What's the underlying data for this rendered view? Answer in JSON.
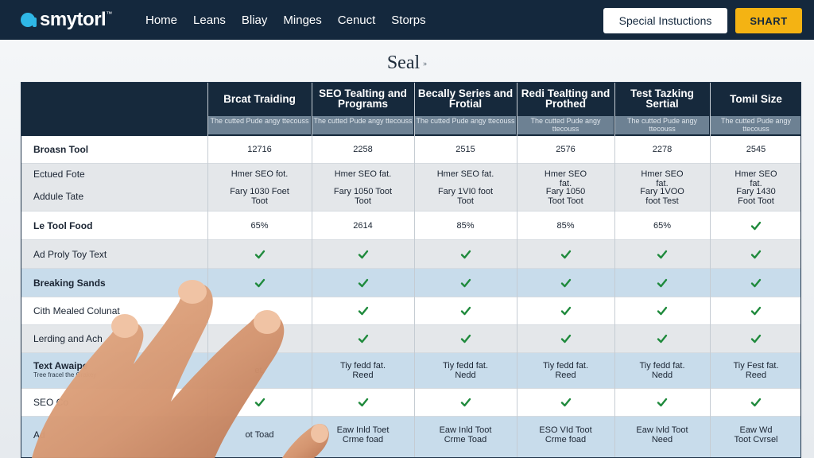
{
  "nav": {
    "logo_text": "smytorl",
    "logo_tm": "™",
    "items": [
      "Home",
      "Leans",
      "Bliay",
      "Minges",
      "Cenuct",
      "Storps"
    ],
    "special_label": "Special Instuctions",
    "start_label": "SHART"
  },
  "page": {
    "title": "Seal",
    "title_mark": "»"
  },
  "table": {
    "columns": [
      {
        "title": "Brcat Traiding",
        "sub": "The cutted Pude angy ttecouss"
      },
      {
        "title": "SEO Tealting and Programs",
        "sub": "The cutted Pude angy ttecouss"
      },
      {
        "title": "Becally Series and Frotial",
        "sub": "The cutted Pude angy ttecouss"
      },
      {
        "title": "Redi Tealting and Prothed",
        "sub": "The cutted Pude angy ttecouss"
      },
      {
        "title": "Test Tazking Sertial",
        "sub": "The cutted Pude angy ttecouss"
      },
      {
        "title": "Tomil Size",
        "sub": "The cutted Pude angy ttecouss"
      }
    ],
    "rows": [
      {
        "label": "Broasn Tool",
        "cells": [
          "12716",
          "2258",
          "2515",
          "2576",
          "2278",
          "2545"
        ]
      },
      {
        "label": "Ectued Fote",
        "cells": [
          "Hmer SEO fot.",
          "Hmer SEO fat.",
          "Hmer SEO fat.",
          "Hmer SEO fat.",
          "Hmer SEO fat.",
          "Hmer SEO fat."
        ]
      },
      {
        "label": "Addule Tate",
        "cells": [
          "Fary 1030 Foet Toot",
          "Fary 1050 Toot Toot",
          "Fary 1VI0 foot Toot",
          "Fary 1050 Toot Toot",
          "Fary 1VOO foot Test",
          "Fary 1430 Foot Toot"
        ]
      },
      {
        "label": "Le Tool Food",
        "cells": [
          "65%",
          "2614",
          "85%",
          "85%",
          "65%",
          "✓"
        ]
      },
      {
        "label": "Ad Proly Toy Text",
        "cells": [
          "✓",
          "✓",
          "✓",
          "✓",
          "✓",
          "✓"
        ]
      },
      {
        "label": "Breaking Sands",
        "cells": [
          "✓",
          "✓",
          "✓",
          "✓",
          "✓",
          "✓"
        ]
      },
      {
        "label": "Cith Mealed Colunat",
        "cells": [
          "",
          "✓",
          "✓",
          "✓",
          "✓",
          "✓"
        ]
      },
      {
        "label": "Lerding and Ach",
        "cells": [
          "",
          "✓",
          "✓",
          "✓",
          "✓",
          "✓"
        ]
      },
      {
        "label": "Text Awaipe",
        "sub": "Tree fracel the Grakey",
        "cells": [
          "et.",
          "Tiy fedd fat. Reed",
          "Tiy fedd fat. Nedd",
          "Tiy fedd fat. Reed",
          "Tiy fedd fat. Nedd",
          "Tiy Fest fat. Reed"
        ]
      },
      {
        "label": "SEO Co",
        "cells": [
          "✓",
          "✓",
          "✓",
          "✓",
          "✓",
          "✓"
        ]
      },
      {
        "label": "Ad",
        "cells": [
          "ot Toad",
          "Eaw Inld Toet Crme foad",
          "Eaw Inld Toot Crme Toad",
          "ESO VId Toot Crme foad",
          "Eaw Ivld Toot Need",
          "Eaw Wd Toot Cvrsel"
        ]
      }
    ]
  },
  "colors": {
    "navbar": "#14283d",
    "accent": "#f4b313",
    "logo_mark": "#2fb7e6",
    "check": "#1f8a3c"
  }
}
